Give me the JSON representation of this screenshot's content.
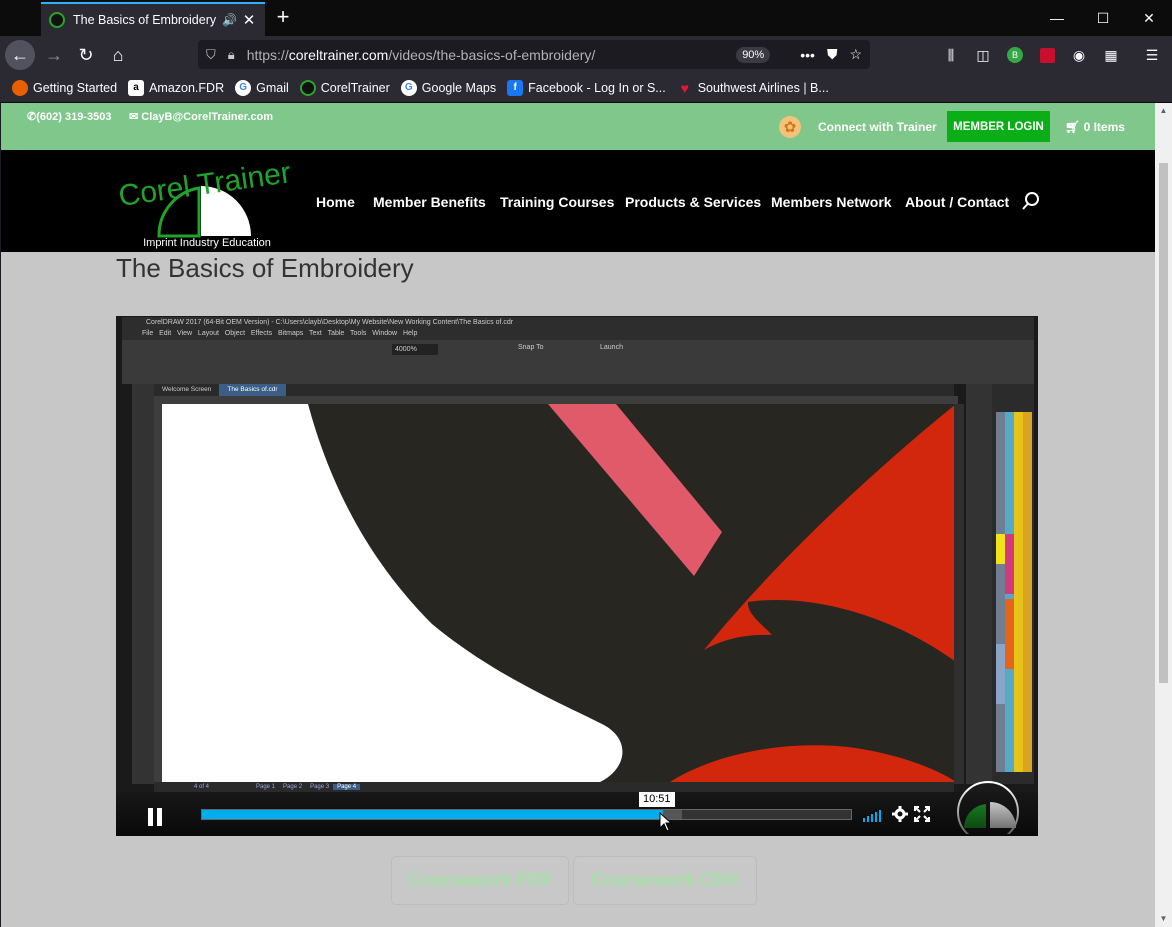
{
  "browser": {
    "tab_title": "The Basics of Embroidery - C",
    "url_prefix": "https://",
    "url_domain": "coreltrainer.com",
    "url_path": "/videos/the-basics-of-embroidery/",
    "zoom": "90%",
    "bookmarks": [
      {
        "label": "Getting Started",
        "icon": "firefox-icon",
        "color": "#e66000"
      },
      {
        "label": "Amazon.FDR",
        "icon": "amazon-icon",
        "color": "#ffffff"
      },
      {
        "label": "Gmail",
        "icon": "google-icon",
        "color": "#ffffff"
      },
      {
        "label": "CorelTrainer",
        "icon": "coreltrainer-icon",
        "color": "#111111"
      },
      {
        "label": "Google Maps",
        "icon": "google-icon",
        "color": "#ffffff"
      },
      {
        "label": "Facebook - Log In or S...",
        "icon": "facebook-icon",
        "color": "#1877f2"
      },
      {
        "label": "Southwest Airlines | B...",
        "icon": "southwest-heart-icon",
        "color": "#304cb2"
      }
    ]
  },
  "site": {
    "phone": "(602) 319-3503",
    "email": "ClayB@CorelTrainer.com",
    "connect": "Connect with Trainer",
    "member_login": "MEMBER LOGIN",
    "cart": "0 Items",
    "logo_text": "Corel Trainer",
    "logo_tagline": "Imprint Industry Education",
    "nav": [
      "Home",
      "Member Benefits",
      "Training Courses",
      "Products & Services",
      "Members Network",
      "About / Contact"
    ],
    "accent_green": "#0aae17",
    "topbar_green": "#7fc78a"
  },
  "main": {
    "title": "The Basics of Embroidery",
    "buttons": [
      "Coursework PDF",
      "Coursework CDR"
    ]
  },
  "video": {
    "app_title": "CorelDRAW 2017 (64-Bit OEM Version) - C:\\Users\\clayb\\Desktop\\My Website\\New Working Content\\The Basics of.cdr",
    "app_menu": [
      "File",
      "Edit",
      "View",
      "Layout",
      "Object",
      "Effects",
      "Bitmaps",
      "Text",
      "Table",
      "Tools",
      "Window",
      "Help"
    ],
    "doc_tabs": [
      "Welcome Screen",
      "The Basics of.cdr"
    ],
    "zoom_field": "4000%",
    "snap_label": "Snap To",
    "launch_label": "Launch",
    "page_tabs": [
      "Page 1",
      "Page 2",
      "Page 3",
      "Page 4"
    ],
    "page_counter": "4 of 4",
    "hover_time": "10:51",
    "progress_fraction": 0.71,
    "buffered_fraction": 0.74
  }
}
